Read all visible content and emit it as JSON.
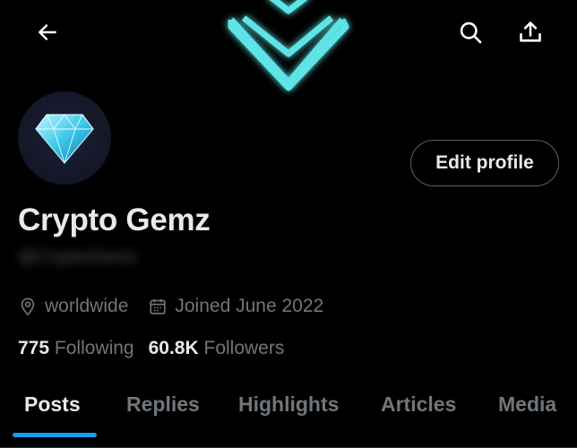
{
  "header": {
    "back_icon": "arrow-left-icon",
    "search_icon": "search-icon",
    "share_icon": "share-icon"
  },
  "colors": {
    "background": "#000000",
    "banner_glow": "#5ee3e6",
    "accent": "#1d9bf0",
    "primary_text": "#e7e9ea",
    "secondary_text": "#71767b"
  },
  "profile": {
    "name": "Crypto Gemz",
    "handle": "@CryptoGemz",
    "edit_button": "Edit profile",
    "location": "worldwide",
    "joined": "Joined June 2022",
    "following_count": "775",
    "following_label": "Following",
    "followers_count": "60.8K",
    "followers_label": "Followers"
  },
  "tabs": [
    {
      "label": "Posts",
      "active": true
    },
    {
      "label": "Replies",
      "active": false
    },
    {
      "label": "Highlights",
      "active": false
    },
    {
      "label": "Articles",
      "active": false
    },
    {
      "label": "Media",
      "active": false
    }
  ]
}
